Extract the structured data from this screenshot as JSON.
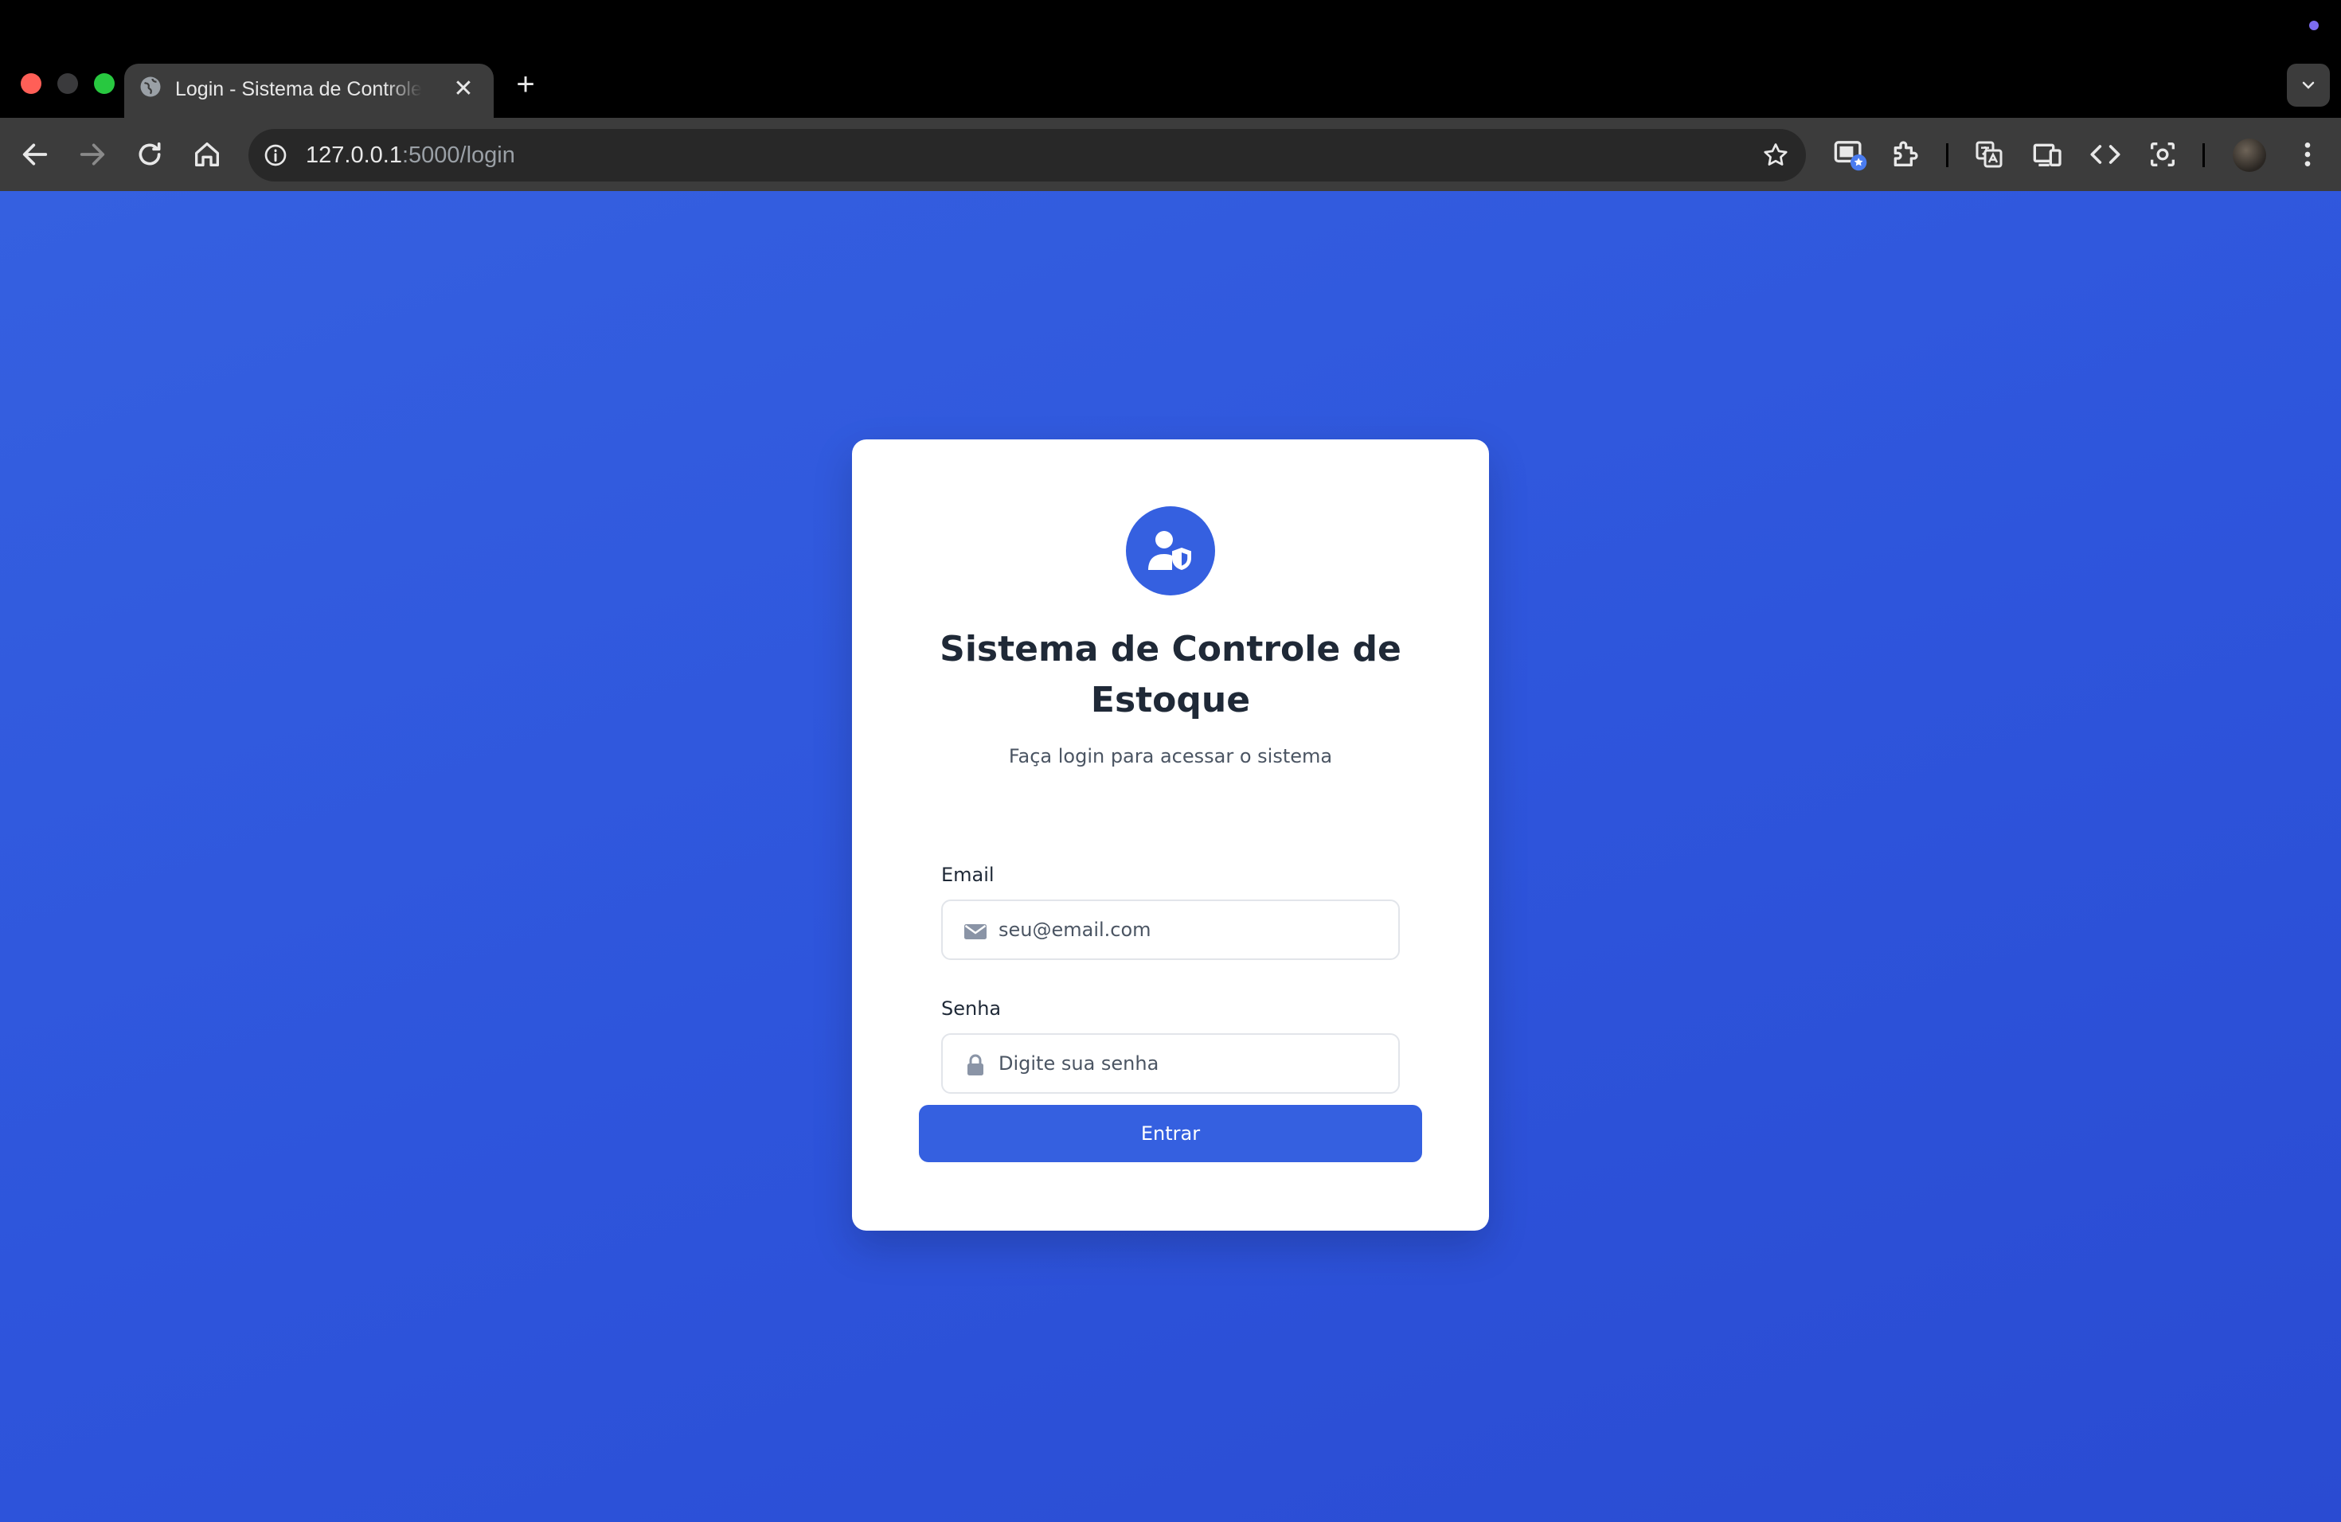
{
  "browser": {
    "tab_title": "Login - Sistema de Controle de Estoque",
    "tab_close": "✕",
    "new_tab": "+",
    "url_host": "127.0.0.1",
    "url_path": ":5000/login"
  },
  "login": {
    "title": "Sistema de Controle de Estoque",
    "subtitle": "Faça login para acessar o sistema",
    "email_label": "Email",
    "email_placeholder": "seu@email.com",
    "password_label": "Senha",
    "password_placeholder": "Digite sua senha",
    "submit_label": "Entrar"
  },
  "colors": {
    "background": "#2e55dc",
    "accent": "#3560e0",
    "card": "#ffffff",
    "title": "#1f2937"
  },
  "icons": [
    "globe-icon",
    "back-icon",
    "forward-icon",
    "reload-icon",
    "home-icon",
    "info-icon",
    "star-icon",
    "cast-icon",
    "extensions-icon",
    "translate-icon",
    "devices-icon",
    "devtools-icon",
    "screenshot-icon",
    "menu-icon",
    "user-shield-icon",
    "envelope-icon",
    "lock-icon"
  ]
}
